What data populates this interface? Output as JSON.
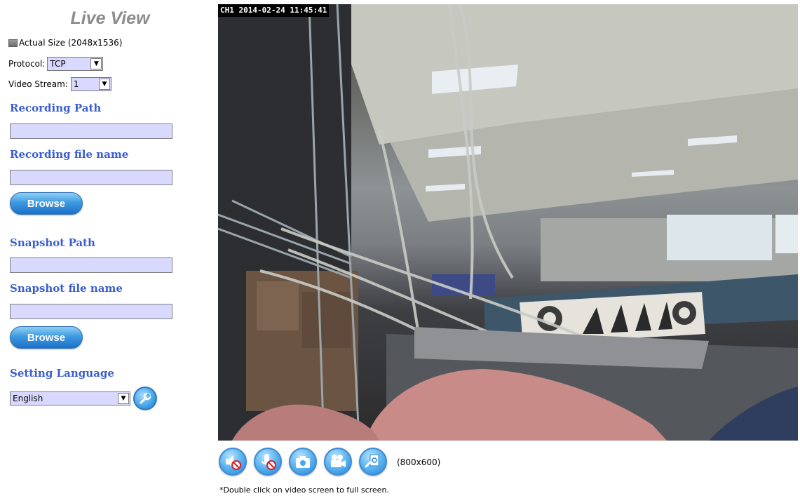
{
  "panel": {
    "title": "Live View",
    "actual_size_label": "Actual Size (2048x1536)",
    "protocol_label": "Protocol:",
    "protocol_value": "TCP",
    "stream_label": "Video Stream:",
    "stream_value": "1",
    "recording_path_label": "Recording Path",
    "recording_path_value": "",
    "recording_file_label": "Recording file name",
    "recording_file_value": "",
    "snapshot_path_label": "Snapshot Path",
    "snapshot_path_value": "",
    "snapshot_file_label": "Snapshot file name",
    "snapshot_file_value": "",
    "browse_label": "Browse",
    "language_label": "Setting Language",
    "language_value": "English",
    "language_apply_icon": "wrench-icon"
  },
  "video": {
    "osd": "CH1 2014-02-24 11:45:41"
  },
  "controls": {
    "buttons": [
      "speaker-muted-icon",
      "microphone-muted-icon",
      "camera-icon",
      "video-camera-icon",
      "zoom-icon"
    ],
    "resolution": "(800x600)",
    "hint": "*Double click on video screen to full screen."
  },
  "colors": {
    "section_label": "#3a5ecf",
    "field_bg": "#d9d9ff",
    "button_blue": "#3e9ae0",
    "title_gray": "#8c8c8c"
  }
}
